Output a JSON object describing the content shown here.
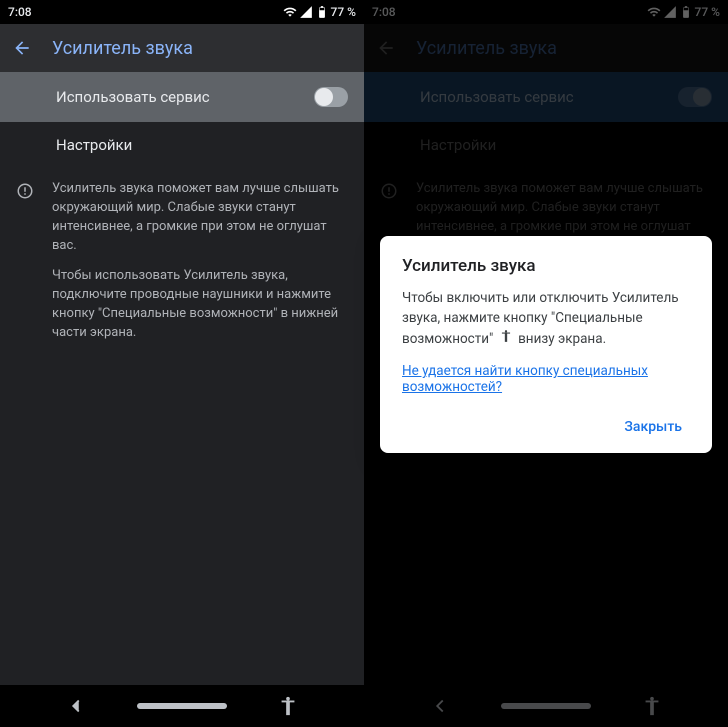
{
  "status_bar": {
    "time": "7:08",
    "battery": "77 %"
  },
  "header": {
    "title": "Усилитель звука"
  },
  "use_service": {
    "label": "Использовать сервис"
  },
  "settings": {
    "label": "Настройки"
  },
  "info": {
    "p1": "Усилитель звука поможет вам лучше слышать окружающий мир. Слабые звуки станут интенсивнее, а громкие при этом не оглушат вас.",
    "p2": "Чтобы использовать Усилитель звука, подключите проводные наушники и нажмите кнопку \"Специальные возможности\" в нижней части экрана."
  },
  "dialog": {
    "title": "Усилитель звука",
    "body_before": "Чтобы включить или отключить Усилитель звука, нажмите кнопку \"Специальные возможности\" ",
    "body_after": " внизу экрана.",
    "link": "Не удается найти кнопку специальных возможностей?",
    "close": "Закрыть"
  }
}
